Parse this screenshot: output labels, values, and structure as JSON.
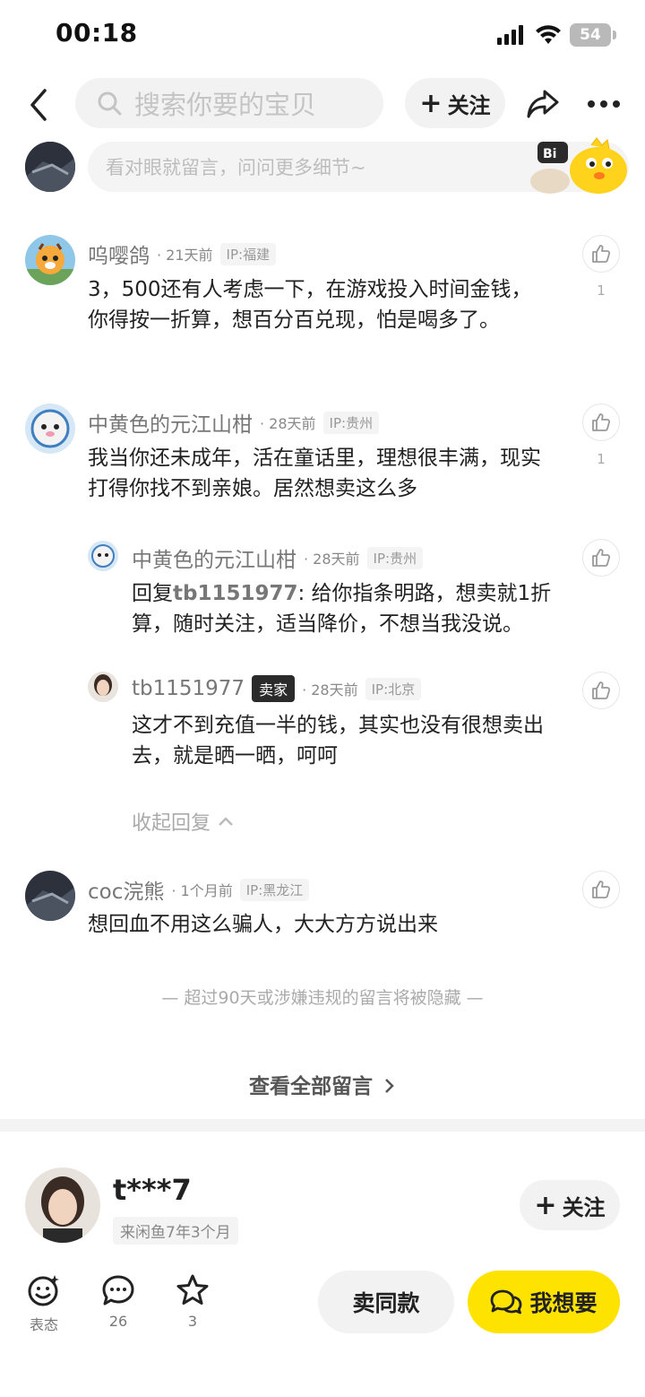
{
  "status_bar": {
    "time": "00:18",
    "battery": "54"
  },
  "header": {
    "search_placeholder": "搜索你要的宝贝",
    "follow_label": "关注"
  },
  "comment_input": {
    "placeholder": "看对眼就留言，问问更多细节~"
  },
  "comments": [
    {
      "name": "呜嘤鸽",
      "time": "21天前",
      "ip": "IP:福建",
      "text": "3，500还有人考虑一下，在游戏投入时间金钱，你得按一折算，想百分百兑现，怕是喝多了。",
      "likes": "1"
    },
    {
      "name": "中黄色的元江山柑",
      "time": "28天前",
      "ip": "IP:贵州",
      "text": "我当你还未成年，活在童话里，理想很丰满，现实打得你找不到亲娘。居然想卖这么多",
      "likes": "1"
    },
    {
      "name": "coc浣熊",
      "time": "1个月前",
      "ip": "IP:黑龙江",
      "text": "想回血不用这么骗人，大大方方说出来"
    }
  ],
  "replies": [
    {
      "name": "中黄色的元江山柑",
      "time": "28天前",
      "ip": "IP:贵州",
      "reply_prefix": "回复",
      "reply_to": "tb1151977",
      "text": ": 给你指条明路，想卖就1折算，随时关注，适当降价，不想当我没说。"
    },
    {
      "name": "tb1151977",
      "badge": "卖家",
      "time": "28天前",
      "ip": "IP:北京",
      "text": "这才不到充值一半的钱，其实也没有很想卖出去，就是晒一晒，呵呵"
    }
  ],
  "collapse_label": "收起回复",
  "hidden_note": "— 超过90天或涉嫌违规的留言将被隐藏 —",
  "view_all_label": "查看全部留言",
  "seller": {
    "name": "t***7",
    "since": "来闲鱼7年3个月",
    "follow_label": "关注"
  },
  "bottom_bar": {
    "react_label": "表态",
    "comment_count": "26",
    "favorite_count": "3",
    "sell_same_label": "卖同款",
    "want_label": "我想要"
  },
  "colors": {
    "accent": "#ffe300",
    "gray_bg": "#f2f2f2"
  }
}
